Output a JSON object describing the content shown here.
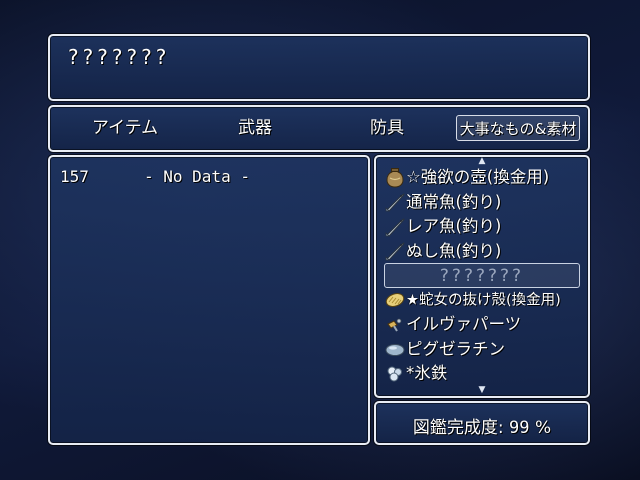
{
  "help": {
    "text": "???????"
  },
  "categories": [
    {
      "label": "アイテム"
    },
    {
      "label": "武器"
    },
    {
      "label": "防具"
    },
    {
      "label": "大事なもの&素材"
    }
  ],
  "info": {
    "id": "157",
    "text": "- No Data -"
  },
  "items": [
    {
      "icon": "jar-icon",
      "label": "☆強欲の壺(換金用)"
    },
    {
      "icon": "fish-icon",
      "label": "通常魚(釣り)"
    },
    {
      "icon": "fish-icon",
      "label": "レア魚(釣り)"
    },
    {
      "icon": "fish-icon",
      "label": "ぬし魚(釣り)"
    },
    {
      "icon": "",
      "label": "???????"
    },
    {
      "icon": "snake-skin-icon",
      "label": "★蛇女の抜け殻(換金用)"
    },
    {
      "icon": "part-icon",
      "label": "イルヴァパーツ"
    },
    {
      "icon": "gelatin-icon",
      "label": "ピグゼラチン"
    },
    {
      "icon": "ice-crystal-icon",
      "label": "*氷鉄"
    }
  ],
  "completion": {
    "label": "図鑑完成度:",
    "value": "99",
    "unit": "%"
  },
  "colors": {
    "window_top": "#1e3460",
    "window_bottom": "#142448",
    "border": "#e8ecf4"
  }
}
